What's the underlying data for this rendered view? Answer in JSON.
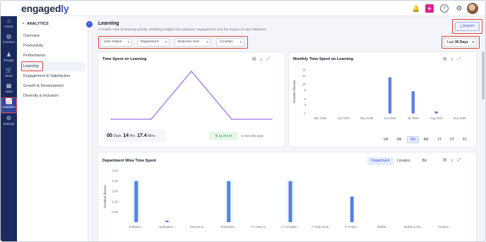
{
  "header": {
    "logo_main": "engaged",
    "logo_accent": "ly",
    "icons": [
      "bell-icon",
      "plus-icon",
      "help-icon",
      "gear-icon",
      "avatar"
    ]
  },
  "rail": {
    "items": [
      {
        "label": "Home",
        "icon": "⌂"
      },
      {
        "label": "Connect",
        "icon": "◍"
      },
      {
        "label": "People",
        "icon": "♟"
      },
      {
        "label": "Store",
        "icon": "🛒"
      },
      {
        "label": "Apps",
        "icon": "▦"
      },
      {
        "label": "Analytics",
        "icon": "📈"
      },
      {
        "label": "Settings",
        "icon": "⚙"
      }
    ]
  },
  "sidebar": {
    "heading": "ANALYTICS",
    "items": [
      {
        "label": "Overview"
      },
      {
        "label": "Productivity"
      },
      {
        "label": "Performance"
      },
      {
        "label": "Learning"
      },
      {
        "label": "Engagement & Satisfaction"
      },
      {
        "label": "Growth & Development"
      },
      {
        "label": "Diversity & Inclusion"
      }
    ]
  },
  "page": {
    "title": "Learning",
    "subtitle": "A holistic view of learning activity, enabling insights into adoption, engagement, and the impact of L&D initiatives.",
    "export_label": "Export",
    "period_prefix": "Last",
    "period_value": "30 Days"
  },
  "filters": [
    {
      "label": "User Status:"
    },
    {
      "label": "Department:"
    },
    {
      "label": "Business Unit:"
    },
    {
      "label": "Location:"
    }
  ],
  "time_spent": {
    "title": "Time Spent on Learning",
    "days_value": "00",
    "days_unit": "Days",
    "hrs_value": "14",
    "hrs_unit": "Hrs",
    "mins_value": "17.4",
    "mins_unit": "Mins",
    "trend_value": "14.29 Hrs",
    "trend_note": "vs last 365 days"
  },
  "monthly": {
    "title": "Monthly Time Spent on Learning",
    "ranges": [
      "1M",
      "3M",
      "6M",
      "9M",
      "1Y",
      "2Y",
      "5Y"
    ],
    "active_range": "6M"
  },
  "department": {
    "title": "Department Wise Time Spent",
    "tabs": [
      "Department",
      "Location",
      "BU"
    ],
    "active_tab": "Department"
  },
  "chart_data": [
    {
      "type": "line",
      "title": "Time Spent on Learning",
      "x": [
        1,
        2,
        3,
        4,
        5
      ],
      "values": [
        0,
        0,
        1,
        0,
        0
      ],
      "grid": false,
      "axes_visible": false,
      "color": "#b08ae6"
    },
    {
      "type": "bar",
      "title": "Monthly Time Spent on Learning",
      "categories": [
        "Mar 2025",
        "Apr 2025",
        "May 2025",
        "Jun 2025",
        "Jul 2025",
        "Aug 2025",
        "Sep 2025"
      ],
      "values": [
        0,
        0,
        0,
        12.5,
        7.7,
        0.8,
        0
      ],
      "ylabel": "Duration (hours)",
      "ylim": [
        0,
        15
      ],
      "yticks": [
        0,
        3,
        5,
        8,
        10,
        13,
        15
      ],
      "grid": false,
      "color": "#5b7fe5"
    },
    {
      "type": "bar",
      "title": "Department Wise Time Spent",
      "categories": [
        "Software...",
        "Application...",
        "DevOps &...",
        "Enterprise...",
        "IT Asset &...",
        "IT Complian...",
        "IT Help Desk...",
        "IT Project...",
        "Mobile...",
        "Mobile & We...",
        "Product..."
      ],
      "values": [
        2.4,
        0.1,
        0,
        2.4,
        0,
        2.4,
        0,
        1.5,
        0,
        0,
        0
      ],
      "ylabel": "Duration (hours)",
      "ylim": [
        0,
        3.0
      ],
      "yticks": [
        "0.60",
        "1.20",
        "1.80",
        "2.40",
        "3.00"
      ],
      "grid": false,
      "color": "#5b7fe5",
      "highlight_color": "#e8fbf7"
    }
  ]
}
